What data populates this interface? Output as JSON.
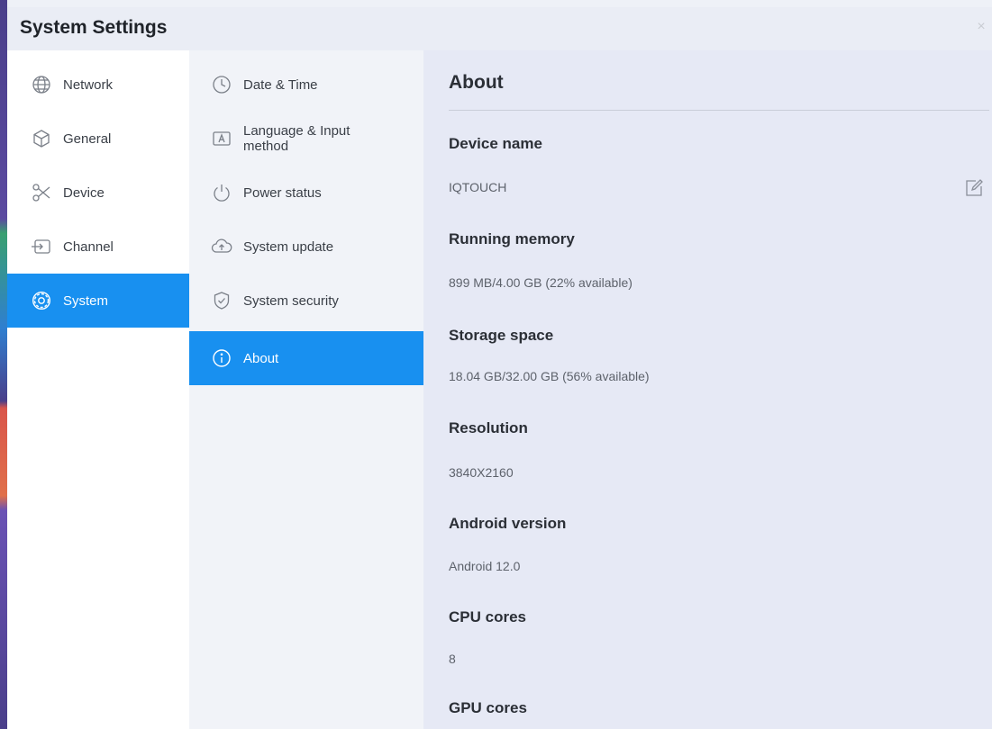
{
  "window": {
    "title": "System Settings",
    "close_label": "×"
  },
  "nav": {
    "items": [
      {
        "label": "Network",
        "icon": "globe-icon"
      },
      {
        "label": "General",
        "icon": "cube-icon"
      },
      {
        "label": "Device",
        "icon": "scissors-icon"
      },
      {
        "label": "Channel",
        "icon": "input-icon"
      },
      {
        "label": "System",
        "icon": "gear-icon",
        "active": true
      }
    ]
  },
  "subnav": {
    "items": [
      {
        "label": "Date & Time",
        "icon": "clock-icon"
      },
      {
        "label": "Language & Input method",
        "icon": "keyboard-a-icon"
      },
      {
        "label": "Power status",
        "icon": "power-icon"
      },
      {
        "label": "System update",
        "icon": "cloud-upload-icon"
      },
      {
        "label": "System security",
        "icon": "shield-check-icon"
      },
      {
        "label": "About",
        "icon": "info-icon",
        "active": true
      }
    ]
  },
  "about": {
    "title": "About",
    "fields": [
      {
        "label": "Device name",
        "value": "IQTOUCH"
      },
      {
        "label": "Running memory",
        "value": "899 MB/4.00 GB (22% available)"
      },
      {
        "label": "Storage space",
        "value": "18.04 GB/32.00 GB (56% available)"
      },
      {
        "label": "Resolution",
        "value": "3840X2160"
      },
      {
        "label": "Android version",
        "value": "Android 12.0"
      },
      {
        "label": "CPU cores",
        "value": "8"
      },
      {
        "label": "GPU cores",
        "value": ""
      }
    ],
    "edit_icon": "edit-icon"
  },
  "colors": {
    "accent": "#1890f0",
    "panel_bg": "#e6e9f5"
  }
}
